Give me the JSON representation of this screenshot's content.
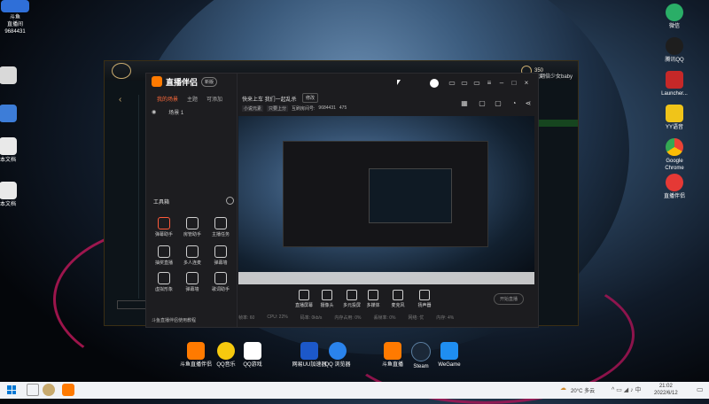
{
  "desktop": {
    "left_icons": [
      {
        "label": "斗鱼\n直播间",
        "color": "#2f6fd8"
      },
      {
        "label": "",
        "color": "#d9d9d9"
      },
      {
        "label": "",
        "color": "#3d7dd8"
      },
      {
        "label": "本文档",
        "color": "#e9e9e9"
      },
      {
        "label": "本文档",
        "color": "#e9e9e9"
      }
    ],
    "room_id": "9684431",
    "right_icons": [
      {
        "label": "微信",
        "color": "#2aae67"
      },
      {
        "label": "腾讯QQ",
        "color": "#1e1e1e"
      },
      {
        "label": "Launcher...",
        "color": "#c62828"
      },
      {
        "label": "YY语音",
        "color": "#f0c419"
      },
      {
        "label": "Google\nChrome",
        "color": "#e0e0e0"
      },
      {
        "label": "直播伴侣",
        "color": "#e53935"
      }
    ],
    "bottom_icons": [
      {
        "label": "斗鱼直播伴侣",
        "color": "#ff7a00"
      },
      {
        "label": "QQ音乐",
        "color": "#f6c90e"
      },
      {
        "label": "QQ游戏",
        "color": "#ffffff"
      },
      {
        "label": "网易UU加速器",
        "color": "#1c58c9"
      },
      {
        "label": "QQ 浏览器",
        "color": "#2a83ec"
      },
      {
        "label": "斗鱼直播",
        "color": "#ff7a00"
      },
      {
        "label": "Steam",
        "color": "#1b2838"
      },
      {
        "label": "WeGame",
        "color": "#1f8ef1"
      }
    ]
  },
  "lol": {
    "currency": "350",
    "friend_name": "我翻倍少女baby"
  },
  "app": {
    "title": "直播伴侣",
    "badge": "新版",
    "tabs": [
      "我的场景",
      "主题",
      "可添加"
    ],
    "live_title": "快来上车 我们一起乱杀",
    "edit_label": "修改",
    "category": "小说元素",
    "tag": "只要上分",
    "room_label": "互刷房间号:",
    "room_id": "9684431",
    "fans": "475",
    "scene": "场景 1",
    "tools_title": "工具箱",
    "tools": [
      {
        "label": "弹幕助手",
        "color": "#ff5a3a"
      },
      {
        "label": "房管助手",
        "color": "#cfcfcf"
      },
      {
        "label": "主播任务",
        "color": "#cfcfcf"
      },
      {
        "label": "抽奖直播",
        "color": "#cfcfcf"
      },
      {
        "label": "多人连麦",
        "color": "#cfcfcf"
      },
      {
        "label": "弹幕墙",
        "color": "#cfcfcf"
      },
      {
        "label": "虚拟形象",
        "color": "#cfcfcf"
      },
      {
        "label": "弹幕墙",
        "color": "#cfcfcf"
      },
      {
        "label": "歌词助手",
        "color": "#cfcfcf"
      }
    ],
    "footer_text": "斗鱼直播伴侣使用教程",
    "bottom_buttons": [
      "直播屏幕",
      "摄像头",
      "多元投屏",
      "多媒体",
      "麦克风",
      "扬声器"
    ],
    "start_button": "开始直播",
    "status": [
      "帧率: 60",
      "CPU: 22%",
      "码率: 0kb/s",
      "内存占用: 0%",
      "丢帧率: 0%",
      "网络: 优",
      "内存: 4%"
    ]
  },
  "taskbar": {
    "weather": "20°C 多云",
    "time": "21:02",
    "date": "2022/6/12"
  }
}
